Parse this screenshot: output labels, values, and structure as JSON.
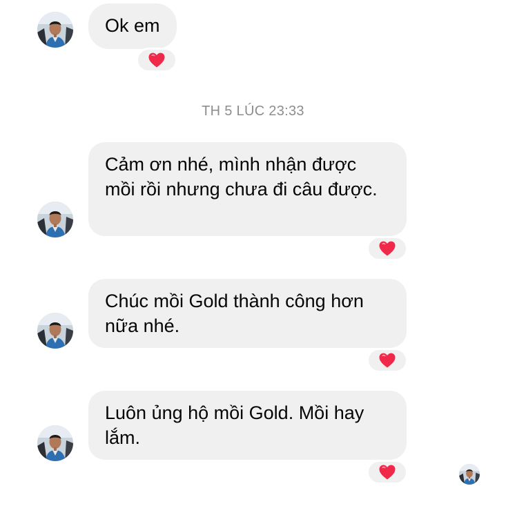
{
  "conversation": {
    "messages": [
      {
        "text": "Ok em",
        "reaction": "heart"
      },
      {
        "text": "Cảm ơn nhé, mình nhận được mồi rồi nhưng chưa đi câu được.",
        "reaction": "heart"
      },
      {
        "text": "Chúc mồi Gold thành công hơn nữa nhé.",
        "reaction": "heart"
      },
      {
        "text": "Luôn ủng hộ mồi Gold. Mồi hay lắm.",
        "reaction": "heart"
      }
    ],
    "timestamp": "TH 5 LÚC 23:33"
  },
  "colors": {
    "bubble": "#f0f0f0",
    "heart": "#f02849",
    "timestamp": "#8a8d91",
    "text": "#050505"
  },
  "icons": {
    "avatar": "contact-avatar-photo",
    "reaction": "heart-icon",
    "seen": "seen-avatar"
  }
}
